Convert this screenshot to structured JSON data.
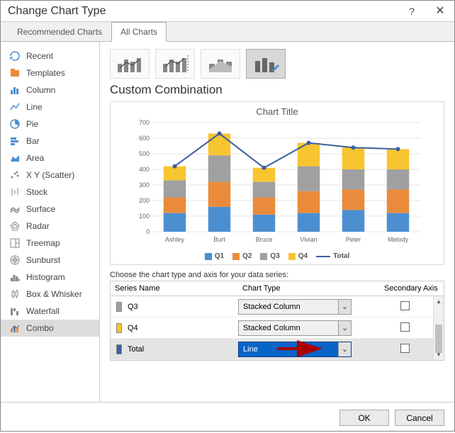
{
  "titlebar": {
    "title": "Change Chart Type"
  },
  "tabs": {
    "recommended": "Recommended Charts",
    "all": "All Charts"
  },
  "sidebar": {
    "items": [
      "Recent",
      "Templates",
      "Column",
      "Line",
      "Pie",
      "Bar",
      "Area",
      "X Y (Scatter)",
      "Stock",
      "Surface",
      "Radar",
      "Treemap",
      "Sunburst",
      "Histogram",
      "Box & Whisker",
      "Waterfall",
      "Combo"
    ]
  },
  "section_title": "Custom Combination",
  "chart": {
    "title": "Chart Title"
  },
  "legend": {
    "q1": "Q1",
    "q2": "Q2",
    "q3": "Q3",
    "q4": "Q4",
    "total": "Total"
  },
  "series_prompt": "Choose the chart type and axis for your data series:",
  "table": {
    "head": {
      "name": "Series Name",
      "type": "Chart Type",
      "axis": "Secondary Axis"
    },
    "rows": {
      "q3": {
        "label": "Q3",
        "type": "Stacked Column"
      },
      "q4": {
        "label": "Q4",
        "type": "Stacked Column"
      },
      "total": {
        "label": "Total",
        "type": "Line"
      }
    }
  },
  "footer": {
    "ok": "OK",
    "cancel": "Cancel"
  },
  "colors": {
    "q1": "#4c8fd1",
    "q2": "#e98b3b",
    "q3": "#a0a0a0",
    "q4": "#f7c530",
    "total": "#3b5fa0"
  },
  "chart_data": {
    "type": "combo",
    "title": "Chart Title",
    "categories": [
      "Ashley",
      "Burt",
      "Bruce",
      "Vivian",
      "Peter",
      "Melody"
    ],
    "series": [
      {
        "name": "Q1",
        "type": "stacked-column",
        "color": "#4c8fd1",
        "values": [
          120,
          160,
          110,
          120,
          140,
          120
        ]
      },
      {
        "name": "Q2",
        "type": "stacked-column",
        "color": "#e98b3b",
        "values": [
          100,
          160,
          110,
          140,
          130,
          150
        ]
      },
      {
        "name": "Q3",
        "type": "stacked-column",
        "color": "#a0a0a0",
        "values": [
          110,
          170,
          100,
          160,
          130,
          130
        ]
      },
      {
        "name": "Q4",
        "type": "stacked-column",
        "color": "#f7c530",
        "values": [
          90,
          140,
          90,
          150,
          140,
          130
        ]
      },
      {
        "name": "Total",
        "type": "line",
        "color": "#3b5fa0",
        "values": [
          420,
          630,
          410,
          570,
          540,
          530
        ]
      }
    ],
    "y_ticks": [
      0,
      100,
      200,
      300,
      400,
      500,
      600,
      700
    ],
    "ylim": [
      0,
      700
    ]
  }
}
